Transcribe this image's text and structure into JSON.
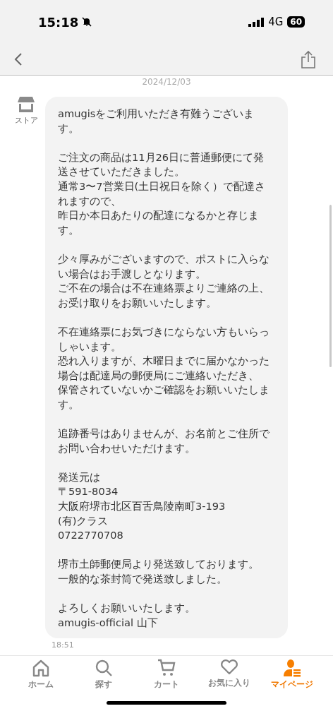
{
  "status_bar": {
    "time": "15:18",
    "network": "4G",
    "battery": "60"
  },
  "date_label": "2024/12/03",
  "message": {
    "sender_label": "ストア",
    "paragraphs": [
      [
        "amugisをご利用いただき有難うございま",
        "す。"
      ],
      [
        "ご注文の商品は11月26日に普通郵便にて発",
        "送させていただきました。",
        "通常3〜7営業日(土日祝日を除く）で配達さ",
        "れますので、",
        "昨日か本日あたりの配達になるかと存じま",
        "す。"
      ],
      [
        "少々厚みがございますので、ポストに入らな",
        "い場合はお手渡しとなります。",
        "ご不在の場合は不在連絡票よりご連絡の上、",
        "お受け取りをお願いいたします。"
      ],
      [
        "不在連絡票にお気づきにならない方もいらっ",
        "しゃいます。",
        "恐れ入りますが、木曜日までに届かなかった",
        "場合は配達局の郵便局にご連絡いただき、",
        "保管されていないかご確認をお願いいたしま",
        "す。"
      ],
      [
        "追跡番号はありませんが、お名前とご住所で",
        "お問い合わせいただけます。"
      ],
      [
        "発送元は",
        "〒591-8034",
        "大阪府堺市北区百舌鳥陵南町3-193",
        "(有)クラス",
        "0722770708"
      ],
      [
        "堺市土師郵便局より発送致しております。",
        "一般的な茶封筒で発送致しました。"
      ],
      [
        "よろしくお願いいたします。",
        "amugis-official 山下"
      ]
    ],
    "time": "18:51"
  },
  "tab_bar": [
    {
      "kind": "home",
      "label": "ホーム",
      "selected": false
    },
    {
      "kind": "search",
      "label": "探す",
      "selected": false
    },
    {
      "kind": "cart",
      "label": "カート",
      "selected": false
    },
    {
      "kind": "heart",
      "label": "お気に入り",
      "selected": false
    },
    {
      "kind": "person",
      "label": "マイページ",
      "selected": true
    }
  ]
}
